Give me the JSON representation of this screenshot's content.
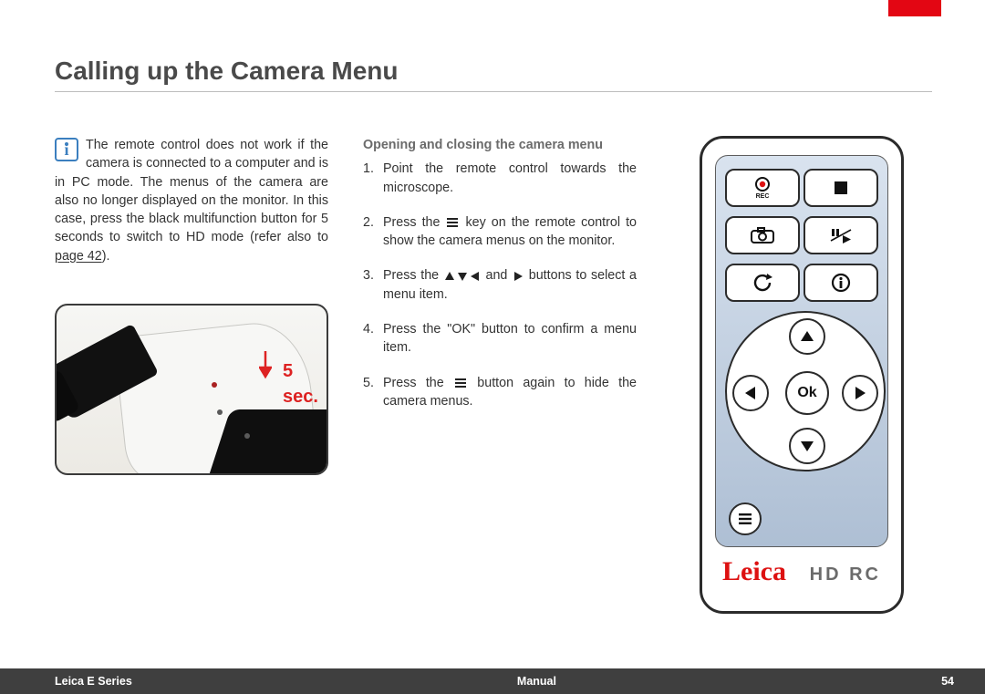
{
  "title": "Calling up the Camera Menu",
  "info_para_pre": "The remote control does not work if the camera is connected to a computer and is in PC mode. The menus of the camera are also no longer displayed on the monitor. In this case, press the black multifunction button for 5 seconds to switch to HD mode (refer also to ",
  "page_ref": "page 42",
  "info_para_post": ").",
  "photo_label": "5 sec.",
  "subhead": "Opening and closing the camera menu",
  "steps": {
    "s1": "Point the remote control towards the microscope.",
    "s2a": "Press the ",
    "s2b": " key on the remote control to show the camera menus on the monitor.",
    "s3a": "Press the ",
    "s3b": " and ",
    "s3c": " buttons to select a menu item.",
    "s4": "Press the \"OK\" button to confirm a menu item.",
    "s5a": "Press the ",
    "s5b": " button again to hide the camera menus."
  },
  "remote": {
    "ok": "Ok",
    "brand": "Leica",
    "model": "HD RC",
    "rec": "REC"
  },
  "footer": {
    "left": "Leica E Series",
    "center": "Manual",
    "page": "54"
  }
}
